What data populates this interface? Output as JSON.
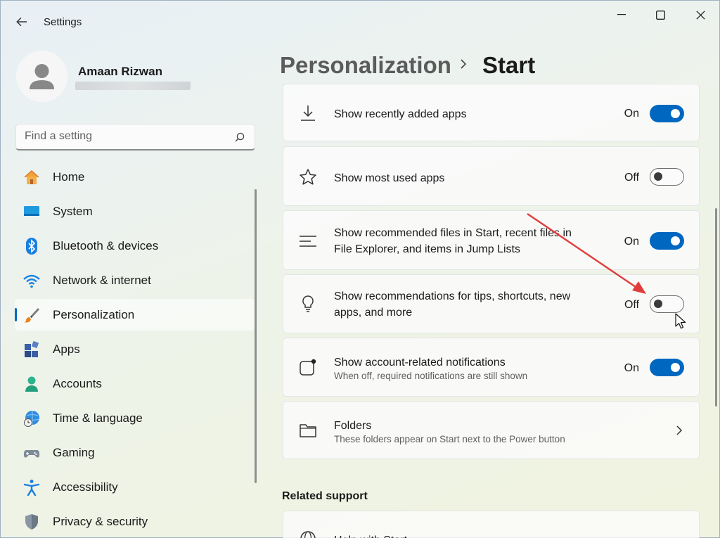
{
  "window": {
    "title": "Settings"
  },
  "user": {
    "name": "Amaan Rizwan"
  },
  "search": {
    "placeholder": "Find a setting"
  },
  "nav": [
    {
      "label": "Home",
      "icon": "home-icon"
    },
    {
      "label": "System",
      "icon": "system-icon"
    },
    {
      "label": "Bluetooth & devices",
      "icon": "bluetooth-icon"
    },
    {
      "label": "Network & internet",
      "icon": "wifi-icon"
    },
    {
      "label": "Personalization",
      "icon": "brush-icon",
      "selected": true
    },
    {
      "label": "Apps",
      "icon": "apps-icon"
    },
    {
      "label": "Accounts",
      "icon": "accounts-icon"
    },
    {
      "label": "Time & language",
      "icon": "time-language-icon"
    },
    {
      "label": "Gaming",
      "icon": "gamepad-icon"
    },
    {
      "label": "Accessibility",
      "icon": "accessibility-icon"
    },
    {
      "label": "Privacy & security",
      "icon": "shield-icon"
    }
  ],
  "breadcrumb": {
    "parent": "Personalization",
    "current": "Start"
  },
  "settings": [
    {
      "title": "Show recently added apps",
      "state": "On",
      "icon": "download-icon"
    },
    {
      "title": "Show most used apps",
      "state": "Off",
      "icon": "star-icon"
    },
    {
      "title_line1": "Show recommended files in Start, recent files in",
      "title_line2": "File Explorer, and items in Jump Lists",
      "state": "On",
      "icon": "list-icon"
    },
    {
      "title_line1": "Show recommendations for tips, shortcuts, new",
      "title_line2": "apps, and more",
      "state": "Off",
      "icon": "lightbulb-icon"
    },
    {
      "title": "Show account-related notifications",
      "subtitle": "When off, required notifications are still shown",
      "state": "On",
      "icon": "notification-icon"
    },
    {
      "title": "Folders",
      "subtitle": "These folders appear on Start next to the Power button",
      "icon": "folder-icon"
    }
  ],
  "related": {
    "heading": "Related support",
    "item_label": "Help with Start"
  },
  "colors": {
    "accent": "#0067c0",
    "annotation_arrow": "#e03c3c"
  }
}
